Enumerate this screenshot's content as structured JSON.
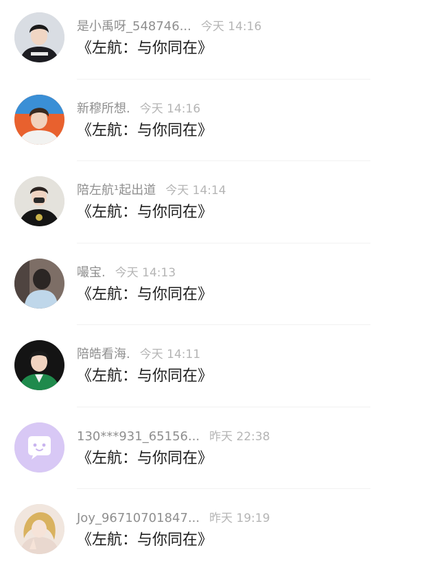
{
  "comments": [
    {
      "user": "是小禹呀_548746...",
      "time": "今天 14:16",
      "text": "《左航：与你同在》",
      "avatar": "boy-black-hoodie-avatar"
    },
    {
      "user": "新穆所想.",
      "time": "今天 14:16",
      "text": "《左航：与你同在》",
      "avatar": "boy-white-shirt-avatar"
    },
    {
      "user": "陪左航¹起出道",
      "time": "今天 14:14",
      "text": "《左航：与你同在》",
      "avatar": "boy-black-tee-avatar"
    },
    {
      "user": "嘬宝.",
      "time": "今天 14:13",
      "text": "《左航：与你同在》",
      "avatar": "boy-back-view-avatar"
    },
    {
      "user": "陪皓看海.",
      "time": "今天 14:11",
      "text": "《左航：与你同在》",
      "avatar": "boy-green-jacket-avatar"
    },
    {
      "user": "130***931_65156...",
      "time": "昨天 22:38",
      "text": "《左航：与你同在》",
      "avatar": "chat-bubble-default-avatar"
    },
    {
      "user": "Joy_96710701847...",
      "time": "昨天 19:19",
      "text": "《左航：与你同在》",
      "avatar": "anime-girl-avatar"
    }
  ],
  "colors": {
    "username": "#8f8f8f",
    "time": "#b5b5b5",
    "comment_text": "#1e1e1e",
    "default_avatar_bg": "#d8c8f5"
  }
}
